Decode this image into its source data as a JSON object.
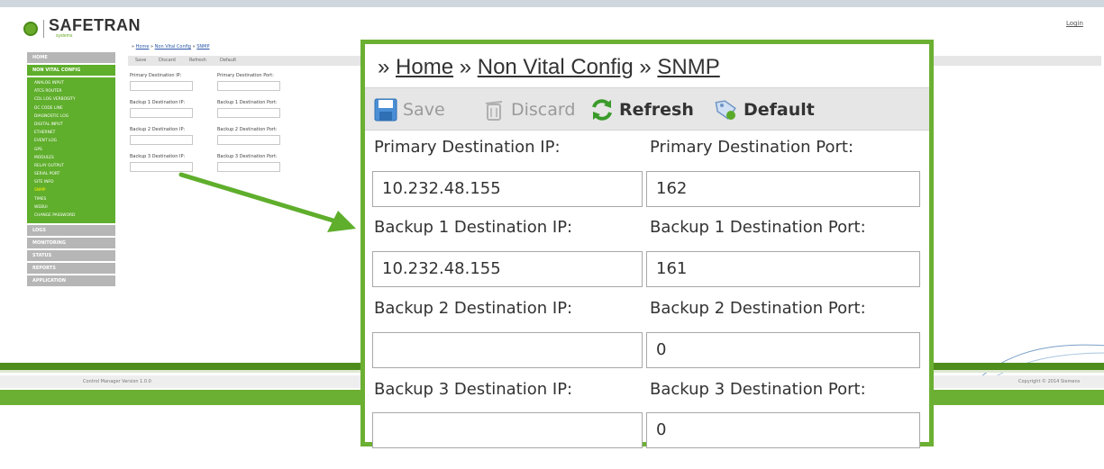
{
  "header": {
    "logo_text": "SAFETRAN",
    "logo_sub": "systems",
    "login": "Login"
  },
  "sidebar": {
    "top_item": "HOME",
    "section": "NON VITAL CONFIG",
    "sub_items": [
      "ANALOG INPUT",
      "ATCS ROUTER",
      "CDL LOG VERBOSITY",
      "DC CODE LINE",
      "DIAGNOSTIC LOG",
      "DIGITAL INPUT",
      "ETHERNET",
      "EVENT LOG",
      "GPS",
      "MODULES",
      "RELAY OUTPUT",
      "SERIAL PORT",
      "SITE INFO",
      "SNMP",
      "TIMES",
      "WEBUI",
      "CHANGE PASSWORD"
    ],
    "bottom_items": [
      "LOGS",
      "MONITORING",
      "STATUS",
      "REPORTS",
      "APPLICATION"
    ]
  },
  "small_breadcrumb": {
    "prefix": "» ",
    "home": "Home",
    "sep": " » ",
    "config": "Non Vital Config",
    "page": "SNMP"
  },
  "small_toolbar": {
    "save": "Save",
    "discard": "Discard",
    "refresh": "Refresh",
    "default": "Default"
  },
  "footer": {
    "version": "Control Manager Version 1.0.0",
    "copyright": "Copyright © 2014 Siemens"
  },
  "zoom": {
    "breadcrumb": {
      "prefix": "» ",
      "home": "Home",
      "sep1": " » ",
      "config": "Non Vital Config",
      "sep2": " » ",
      "page": "SNMP"
    },
    "toolbar": {
      "save": "Save",
      "discard": "Discard",
      "refresh": "Refresh",
      "default": "Default"
    },
    "fields": [
      {
        "ip_label": "Primary Destination IP:",
        "port_label": "Primary Destination Port:",
        "ip_value": "10.232.48.155",
        "port_value": "162"
      },
      {
        "ip_label": "Backup 1 Destination IP:",
        "port_label": "Backup 1 Destination Port:",
        "ip_value": "10.232.48.155",
        "port_value": "161"
      },
      {
        "ip_label": "Backup 2 Destination IP:",
        "port_label": "Backup 2 Destination Port:",
        "ip_value": "",
        "port_value": "0"
      },
      {
        "ip_label": "Backup 3 Destination IP:",
        "port_label": "Backup 3 Destination Port:",
        "ip_value": "",
        "port_value": "0"
      }
    ]
  },
  "colors": {
    "brand_green": "#6cb033",
    "sidebar_green": "#5fae2c",
    "footer_dark_green": "#4e8d1c",
    "toolbar_grey": "#e6e6e6",
    "active_item": "#fff200"
  }
}
